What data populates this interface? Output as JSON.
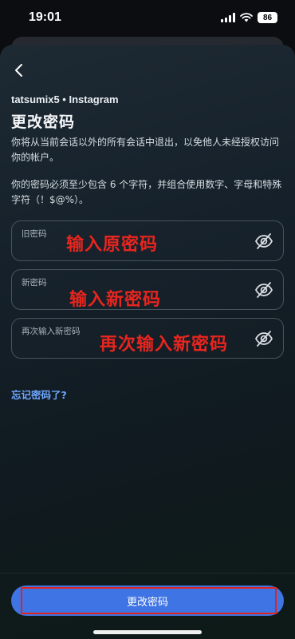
{
  "status_bar": {
    "time": "19:01",
    "battery": "86"
  },
  "header": {
    "back_icon": "chevron-left-icon",
    "account_line": "tatsumix5 • Instagram",
    "title": "更改密码"
  },
  "description": {
    "line1": "你将从当前会话以外的所有会话中退出，以免他人未经授权访问你的帐户。",
    "line2": "你的密码必须至少包含 6 个字符，并组合使用数字、字母和特殊字符（！$@%）。"
  },
  "fields": [
    {
      "label": "旧密码",
      "annotation": "输入原密码",
      "value": "",
      "icon": "eye-slash-icon"
    },
    {
      "label": "新密码",
      "annotation": "输入新密码",
      "value": "",
      "icon": "eye-slash-icon"
    },
    {
      "label": "再次输入新密码",
      "annotation": "再次输入新密码",
      "value": "",
      "icon": "eye-slash-icon"
    }
  ],
  "forgot_link": "忘记密码了?",
  "submit_label": "更改密码",
  "colors": {
    "accent_button": "#3f74e4",
    "link": "#6fa8ff",
    "annotation": "#e8251e"
  }
}
